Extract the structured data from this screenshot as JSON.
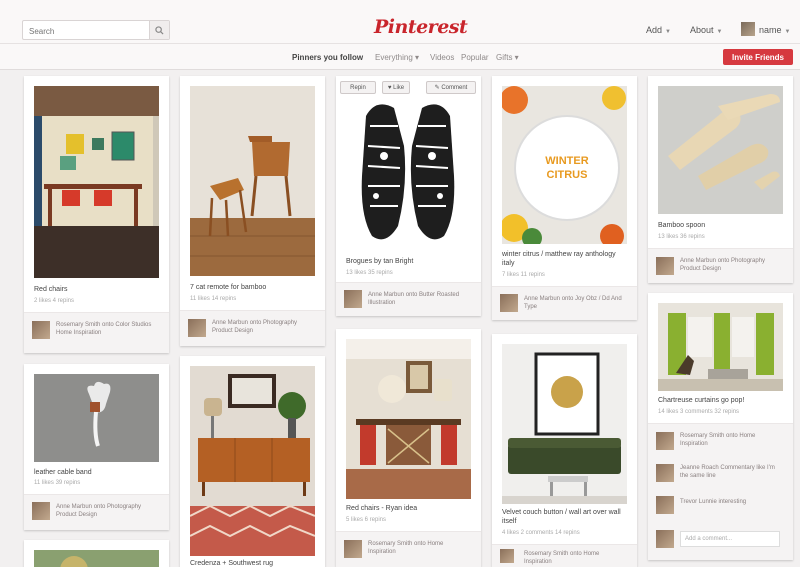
{
  "header": {
    "search_placeholder": "Search",
    "logo": "Pinterest",
    "add_label": "Add",
    "about_label": "About",
    "user_label": "name"
  },
  "subnav": {
    "pinners_you_follow": "Pinners you follow",
    "everything": "Everything",
    "videos": "Videos",
    "popular": "Popular",
    "gifts": "Gifts",
    "invite_label": "Invite Friends"
  },
  "pins": {
    "red_chairs": {
      "desc": "Red chairs",
      "stats": "2 likes  4 repins",
      "via": "Rosemary Smith onto Color Studios  Home Inspiration"
    },
    "eames": {
      "desc": "7 cat remote for bamboo",
      "stats": "11 likes  14 repins",
      "via": "Anne Marbun onto Photography  Product Design"
    },
    "sneakers": {
      "desc": "Brogues by tan Bright",
      "stats": "13 likes  35 repins",
      "via": "Anne Marbun onto Butter Roasted  Illustration",
      "btn_repin": "Repin",
      "btn_like": "Like",
      "btn_comment": "Comment"
    },
    "winter": {
      "desc": "winter citrus / matthew ray anthology italy",
      "stats": "7 likes  11 repins",
      "via": "Anne Marbun onto Joy Obz / Dd And  Type",
      "plate_text": "WINTER CITRUS"
    },
    "spoons": {
      "desc": "Bamboo spoon",
      "stats": "13 likes  36 repins",
      "via": "Anne Marbun onto Photography  Product Design"
    },
    "cable": {
      "desc": "leather cable band",
      "stats": "11 likes  39 repins",
      "via": "Anne Marbun onto Photography  Product Design"
    },
    "credenza": {
      "desc": "Credenza + Southwest rug"
    },
    "chairs2": {
      "desc": "Red chairs - Ryan idea",
      "stats": "5 likes  6 repins",
      "via": "Rosemary Smith onto Home Inspiration"
    },
    "velvet": {
      "desc": "Velvet couch button / wall art over wall itself",
      "stats": "4 likes  2 comments  14 repins",
      "via": "Rosemary Smith onto Home Inspiration"
    },
    "curtains": {
      "desc": "Chartreuse curtains go pop!",
      "stats": "14 likes  3 comments  32 repins",
      "c1": "Rosemary Smith onto Home Inspiration",
      "c2": "Jeanne Roach Commentary like I'm the same line",
      "c3": "Trevor Lunnie interesting",
      "add_comment": "Add a comment..."
    }
  },
  "colors": {
    "brand": "#c9252c",
    "invite": "#d6393f"
  }
}
